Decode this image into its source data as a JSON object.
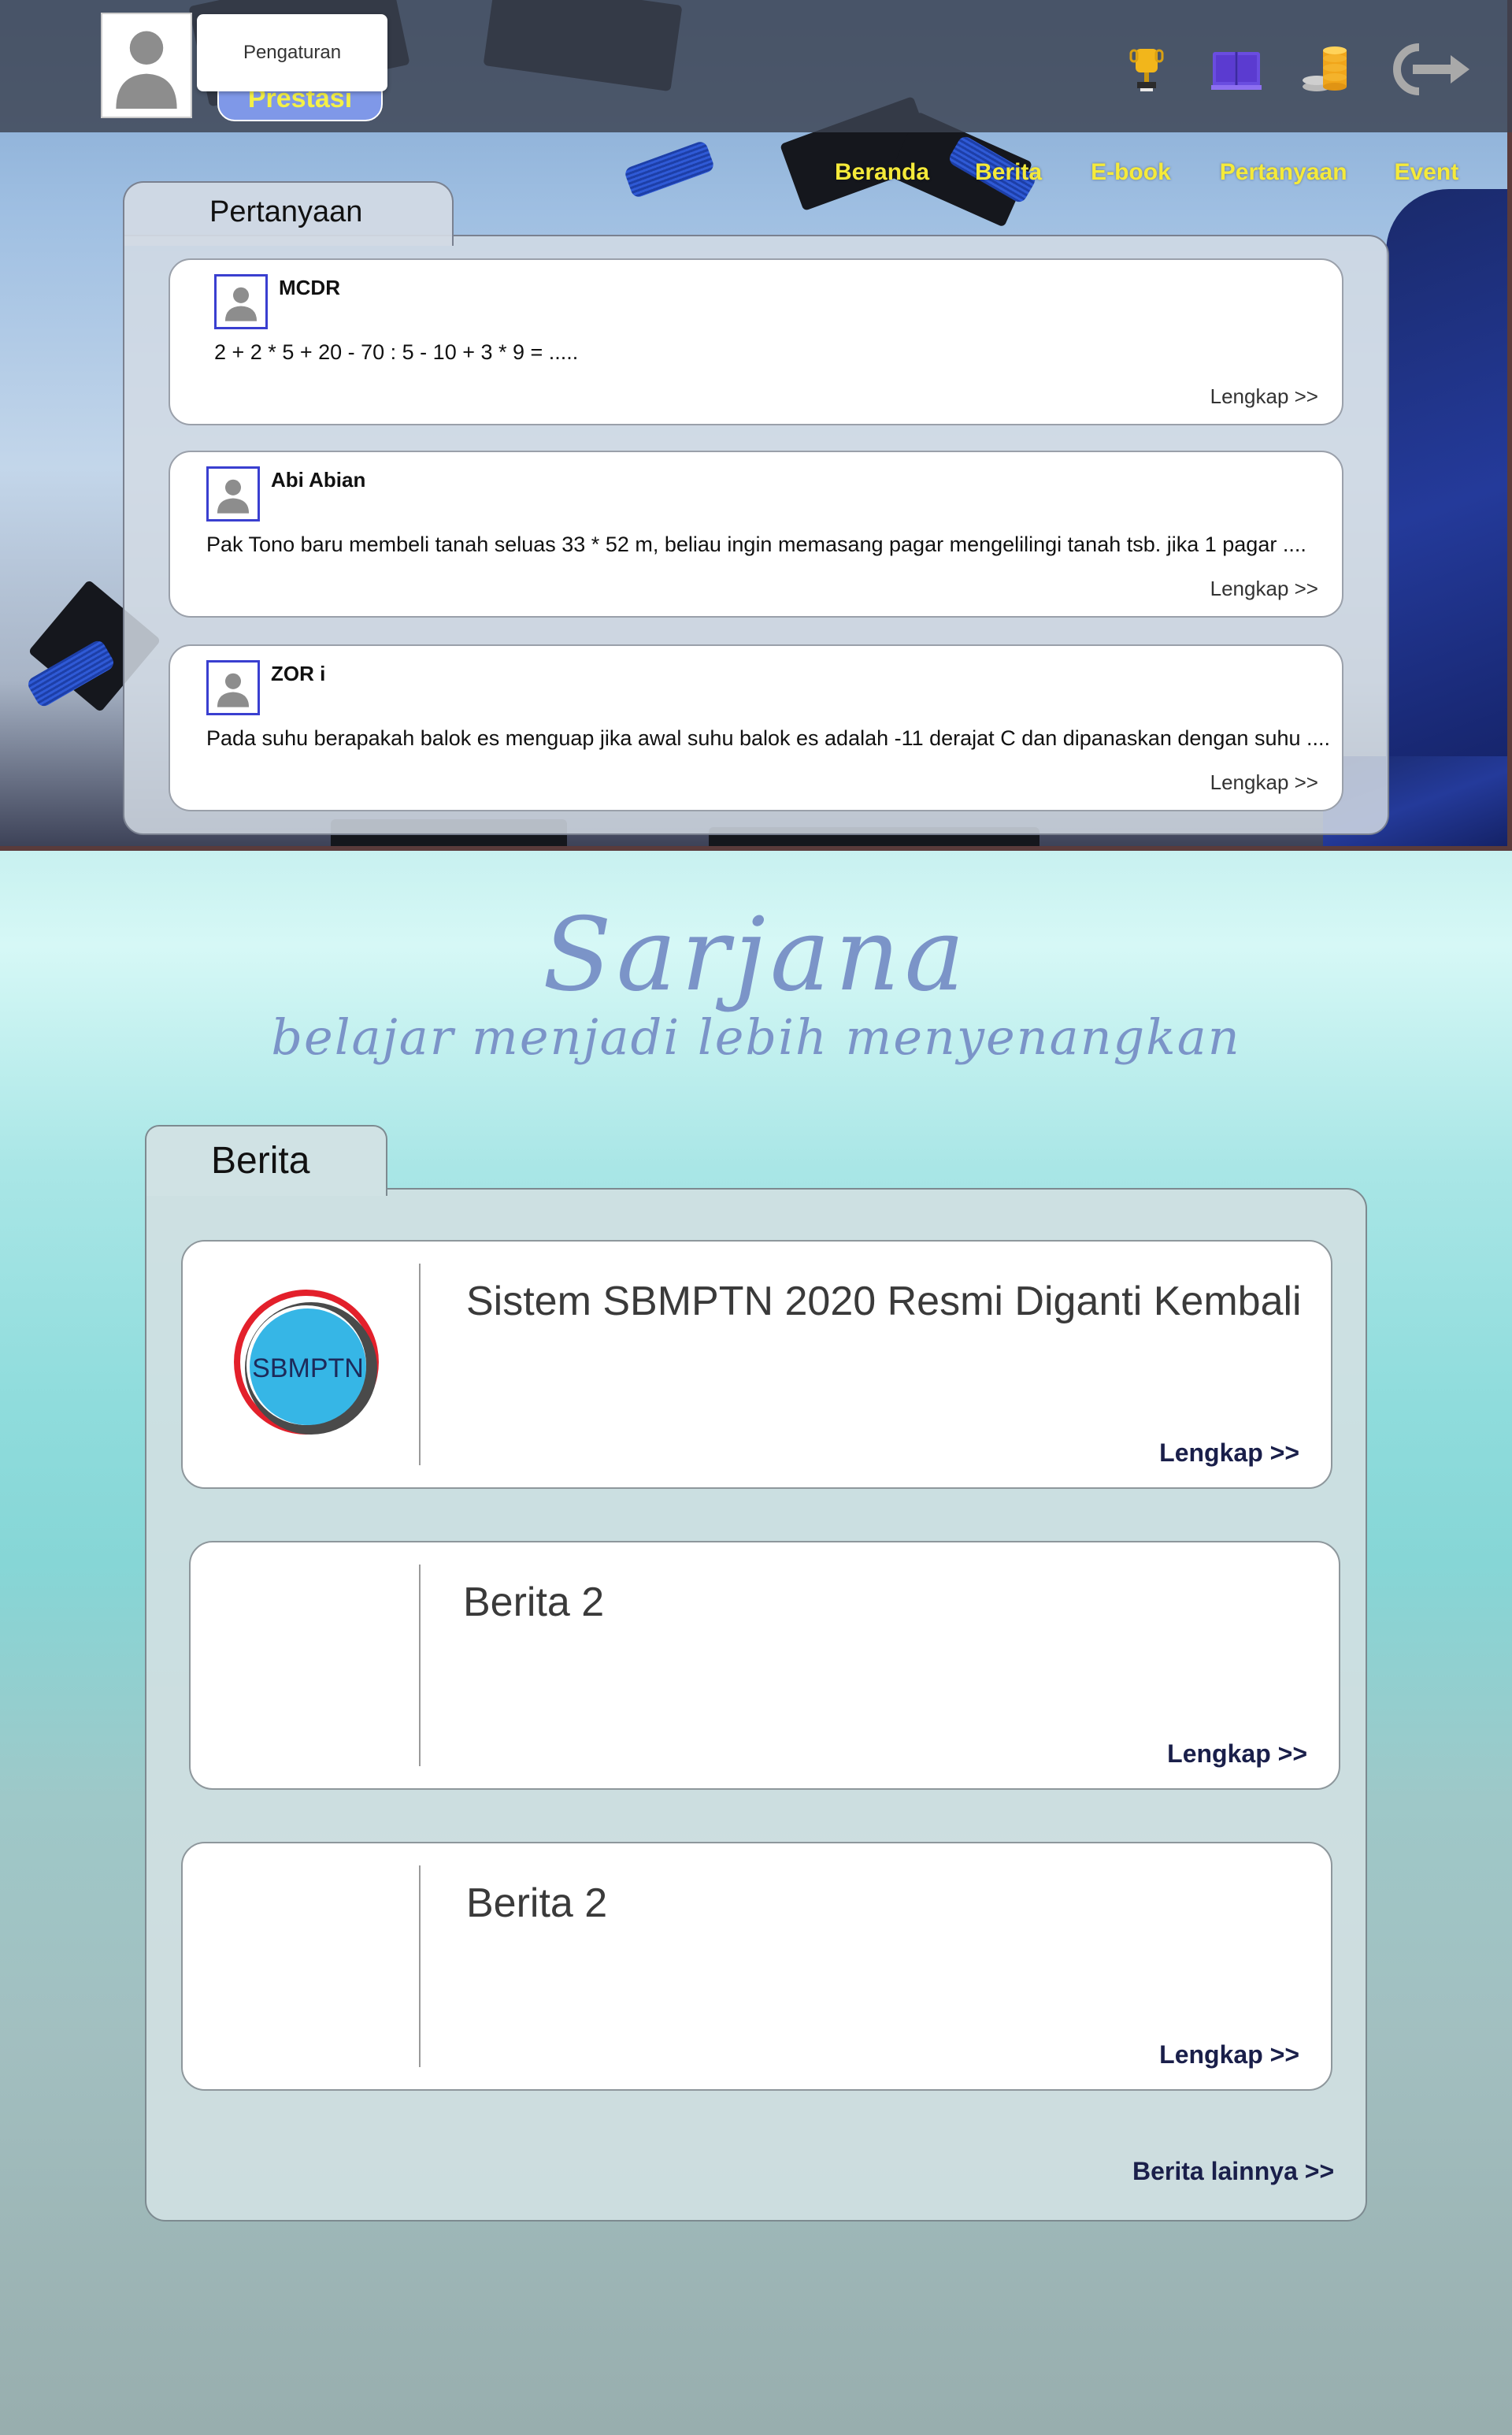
{
  "header": {
    "settings_label": "Pengaturan",
    "prestasi_label": "Prestasi",
    "icons": [
      "trophy-icon",
      "book-icon",
      "coins-icon",
      "logout-icon"
    ]
  },
  "nav": {
    "items": [
      "Beranda",
      "Berita",
      "E-book",
      "Pertanyaan",
      "Event"
    ]
  },
  "questions": {
    "tab_label": "Pertanyaan",
    "items": [
      {
        "user": "MCDR",
        "text": "2 + 2 * 5 + 20 - 70  : 5 - 10 + 3 * 9 = .....",
        "more": "Lengkap >>"
      },
      {
        "user": "Abi Abian",
        "text": "Pak Tono baru membeli tanah seluas 33 * 52 m, beliau ingin memasang pagar mengelilingi tanah tsb. jika 1 pagar ....",
        "more": "Lengkap >>"
      },
      {
        "user": "ZOR i",
        "text": "Pada suhu berapakah balok es menguap jika awal suhu balok es adalah -11 derajat C dan dipanaskan dengan suhu ....",
        "more": "Lengkap >>"
      }
    ]
  },
  "brand": {
    "name": "Sarjana",
    "tagline": "belajar menjadi lebih menyenangkan"
  },
  "news": {
    "tab_label": "Berita",
    "items": [
      {
        "title": "Sistem SBMPTN 2020 Resmi Diganti Kembali",
        "logo_text": "SBMPTN",
        "more": "Lengkap >>"
      },
      {
        "title": "Berita 2",
        "more": "Lengkap >>"
      },
      {
        "title": "Berita 2",
        "more": "Lengkap >>"
      }
    ],
    "all_label": "Berita lainnya >>"
  }
}
